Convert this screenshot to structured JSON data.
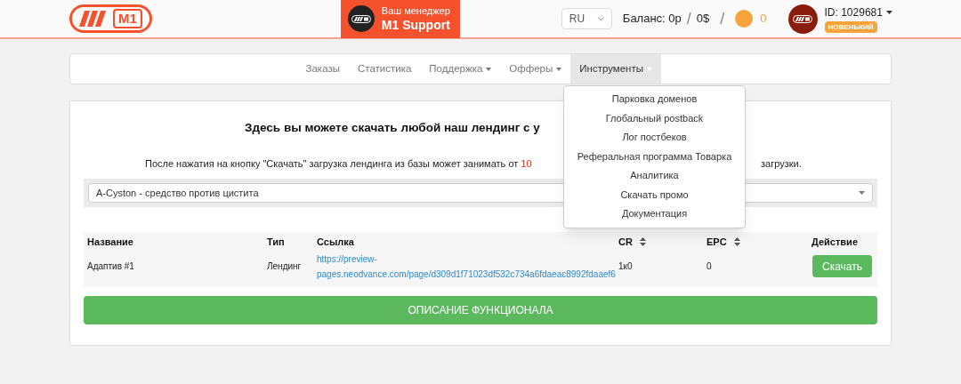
{
  "header": {
    "logo": "M1",
    "manager": {
      "label": "Ваш менеджер",
      "name": "M1 Support"
    },
    "language": "RU",
    "balance_label": "Баланс: 0р",
    "separator_1": "/",
    "balance_usd": "0$",
    "separator_2": "/",
    "coins": "0",
    "user_id": "ID: 1029681",
    "badge": "НОВЕНЬКИЙ"
  },
  "nav": [
    {
      "label": "Заказы",
      "dropdown": false,
      "selected": false
    },
    {
      "label": "Статистика",
      "dropdown": false,
      "selected": false
    },
    {
      "label": "Поддержка",
      "dropdown": true,
      "selected": false
    },
    {
      "label": "Офферы",
      "dropdown": true,
      "selected": false
    },
    {
      "label": "Инструменты",
      "dropdown": true,
      "selected": true
    }
  ],
  "menu": [
    "Парковка доменов",
    "Глобальный postback",
    "Лог постбеков",
    "Реферальная программа Товарка",
    "Аналитика",
    "Скачать промо",
    "Документация"
  ],
  "heading": "Здесь вы можете скачать любой наш лендинг с у",
  "notice": {
    "text": "После нажатия на кнопку \"Скачать\" загрузка лендинга из базы может занимать от ",
    "highlight": "10",
    "tail": "загрузки."
  },
  "offer_select": "A-Cyston - средство против цистита",
  "table": {
    "columns": [
      {
        "label": "Название",
        "sortable": false
      },
      {
        "label": "Тип",
        "sortable": false
      },
      {
        "label": "Ссылка",
        "sortable": false
      },
      {
        "label": "CR",
        "sortable": true
      },
      {
        "label": "EPC",
        "sortable": true
      },
      {
        "label": "Действие",
        "sortable": false
      }
    ],
    "rows": [
      {
        "name": "Адаптив #1",
        "type": "Лендинг",
        "link": [
          "https://preview-",
          "pages.neodvance.com/page/d309d1f71023df532c734a6fdaeac8992fdaaef6"
        ],
        "cr": "1к0",
        "epc": "0",
        "action": "Скачать"
      }
    ]
  },
  "description_button": "ОПИСАНИЕ ФУНКЦИОНАЛА"
}
